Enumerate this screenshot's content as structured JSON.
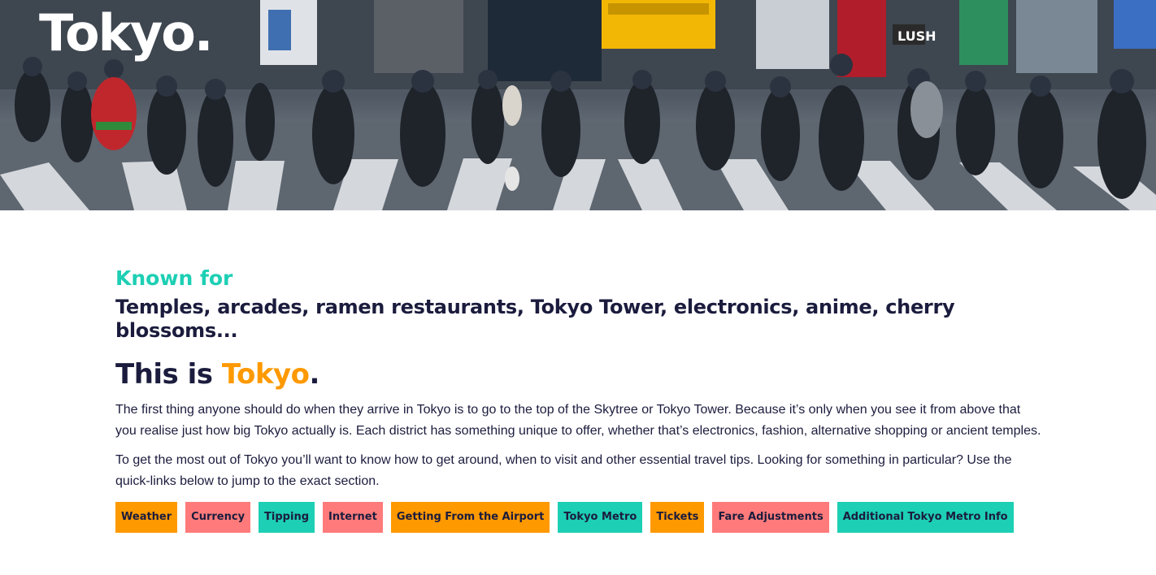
{
  "hero": {
    "title": "Tokyo.",
    "image_alt": "Crowd crossing a street in Tokyo",
    "sign_text": "LUSH"
  },
  "main": {
    "known_for_label": "Known for",
    "known_for_text": "Temples, arcades, ramen restaurants, Tokyo Tower, electronics, anime, cherry blossoms...",
    "heading_prefix": "This is ",
    "heading_city": "Tokyo",
    "heading_suffix": ".",
    "paragraphs": [
      "The first thing anyone should do when they arrive in Tokyo is to go to the top of the Skytree or Tokyo Tower. Because it’s only when you see it from above that you realise just how big Tokyo actually is. Each district has something unique to offer, whether that’s electronics, fashion, alternative shopping or ancient temples.",
      "To get the most out of Tokyo you’ll want to know how to get around, when to visit and other essential travel tips. Looking for something in particular? Use the quick-links below to jump to the exact section."
    ]
  },
  "quick_links": [
    {
      "label": "Weather",
      "color": "#ff9900"
    },
    {
      "label": "Currency",
      "color": "#ff7b7b"
    },
    {
      "label": "Tipping",
      "color": "#1dcfb4"
    },
    {
      "label": "Internet",
      "color": "#ff7b7b"
    },
    {
      "label": "Getting From the Airport",
      "color": "#ff9900"
    },
    {
      "label": "Tokyo Metro",
      "color": "#1dcfb4"
    },
    {
      "label": "Tickets",
      "color": "#ff9900"
    },
    {
      "label": "Fare Adjustments",
      "color": "#ff7b7b"
    },
    {
      "label": "Additional Tokyo Metro Info",
      "color": "#1dcfb4"
    }
  ],
  "colors": {
    "accent_teal": "#1dcfb4",
    "accent_orange": "#ff9900",
    "accent_coral": "#ff7b7b",
    "text_dark": "#1b1c3d"
  }
}
